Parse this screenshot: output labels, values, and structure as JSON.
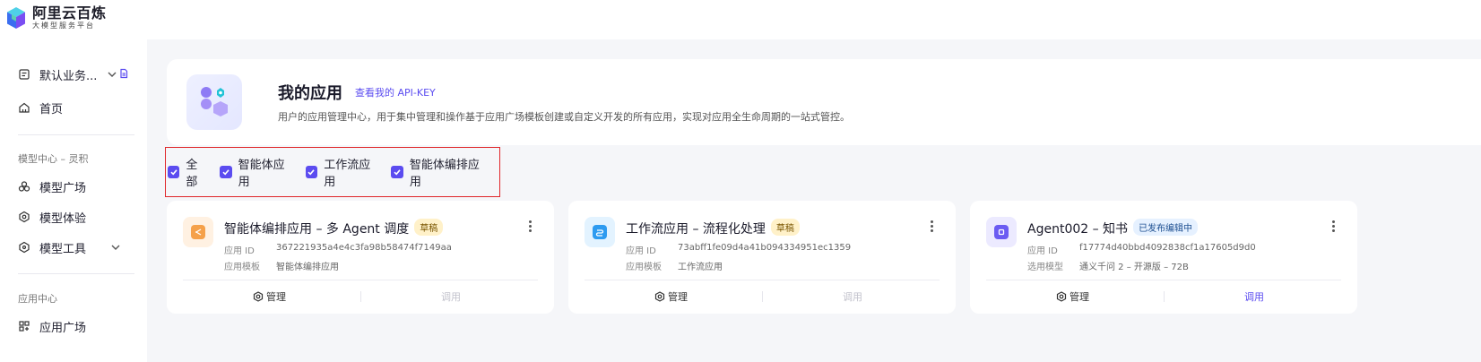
{
  "brand": {
    "title": "阿里云百炼",
    "subtitle": "大模型服务平台"
  },
  "sidebar": {
    "workspace": "默认业务...",
    "home": "首页",
    "section_model": "模型中心 – 灵积",
    "model_items": [
      "模型广场",
      "模型体验",
      "模型工具"
    ],
    "section_app": "应用中心",
    "app_items": [
      "应用广场"
    ]
  },
  "header": {
    "title": "我的应用",
    "api_link": "查看我的 API-KEY",
    "desc": "用户的应用管理中心，用于集中管理和操作基于应用广场模板创建或自定义开发的所有应用，实现对应用全生命周期的一站式管控。"
  },
  "filters": [
    {
      "label": "全部",
      "checked": true
    },
    {
      "label": "智能体应用",
      "checked": true
    },
    {
      "label": "工作流应用",
      "checked": true
    },
    {
      "label": "智能体编排应用",
      "checked": true
    }
  ],
  "cards": [
    {
      "name": "智能体编排应用 – 多 Agent 调度",
      "badge": "草稿",
      "id_label": "应用 ID",
      "id_value": "367221935a4e4c3fa98b58474f7149aa",
      "meta2_label": "应用模板",
      "meta2_value": "智能体编排应用",
      "manage": "管理",
      "call": "调用",
      "icon_color": "#f5a14a",
      "icon_bg": "#fff1e2"
    },
    {
      "name": "工作流应用 – 流程化处理",
      "badge": "草稿",
      "id_label": "应用 ID",
      "id_value": "73abff1fe09d4a41b094334951ec1359",
      "meta2_label": "应用模板",
      "meta2_value": "工作流应用",
      "manage": "管理",
      "call": "调用",
      "icon_color": "#2e9bf0",
      "icon_bg": "#e3f3ff"
    },
    {
      "name": "Agent002 – 知书",
      "badge": "已发布编辑中",
      "id_label": "应用 ID",
      "id_value": "f17774d40bbd4092838cf1a17605d9d0",
      "meta2_label": "选用模型",
      "meta2_value": "通义千问 2 – 开源版 – 72B",
      "manage": "管理",
      "call": "调用",
      "icon_color": "#6b5cf2",
      "icon_bg": "#eceaff"
    }
  ]
}
